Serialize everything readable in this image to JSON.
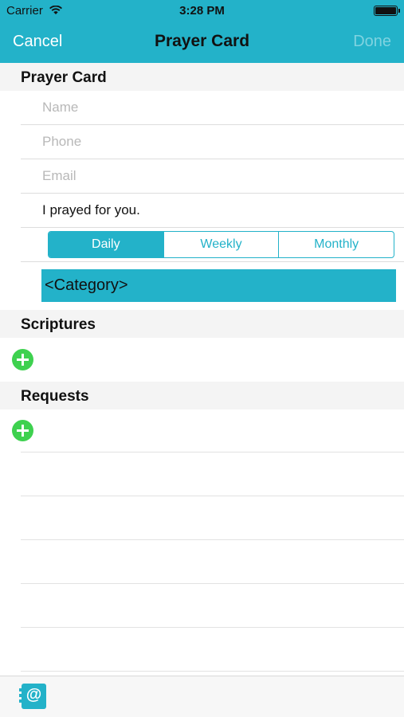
{
  "status_bar": {
    "carrier": "Carrier",
    "time": "3:28 PM"
  },
  "nav": {
    "cancel_label": "Cancel",
    "title": "Prayer Card",
    "done_label": "Done"
  },
  "prayer_card": {
    "header": "Prayer Card",
    "name_placeholder": "Name",
    "phone_placeholder": "Phone",
    "email_placeholder": "Email",
    "message_value": "I prayed for you.",
    "frequency_options": [
      "Daily",
      "Weekly",
      "Monthly"
    ],
    "frequency_selected": "Daily",
    "category_label": "<Category>"
  },
  "scriptures": {
    "header": "Scriptures"
  },
  "requests": {
    "header": "Requests"
  },
  "tabbar": {
    "contacts_icon_glyph": "@"
  },
  "colors": {
    "accent": "#23b2c9",
    "add_green": "#3ed14f",
    "section_bg": "#f4f4f4"
  },
  "icons": [
    "wifi-icon",
    "battery-icon",
    "add-circle-icon",
    "contacts-book-icon"
  ]
}
